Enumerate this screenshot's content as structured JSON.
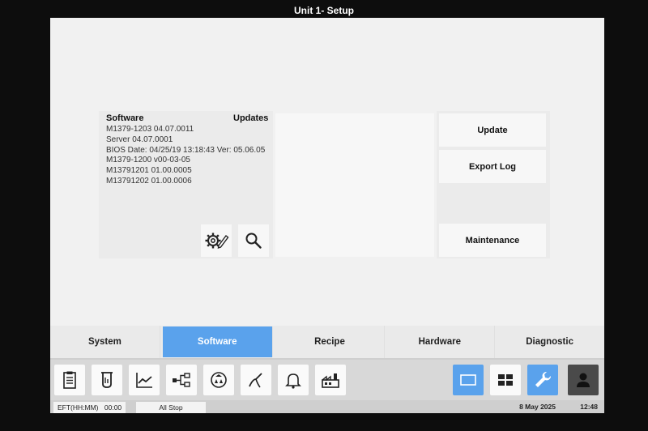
{
  "window": {
    "title": "Unit 1- Setup"
  },
  "software_panel": {
    "heading": "Software",
    "updates_heading": "Updates",
    "versions": [
      "M1379-1203 04.07.0011",
      "Server 04.07.0001",
      "BIOS Date: 04/25/19 13:18:43 Ver: 05.06.05",
      "M1379-1200 v00-03-05",
      "M13791201 01.00.0005",
      "M13791202 01.00.0006"
    ],
    "icons": {
      "settings": "gear-pencil-icon",
      "search": "magnifier-icon"
    }
  },
  "actions": {
    "update": "Update",
    "export_log": "Export Log",
    "maintenance": "Maintenance"
  },
  "tabs": [
    {
      "label": "System",
      "active": false
    },
    {
      "label": "Software",
      "active": true
    },
    {
      "label": "Recipe",
      "active": false
    },
    {
      "label": "Hardware",
      "active": false
    },
    {
      "label": "Diagnostic",
      "active": false
    }
  ],
  "toolbar": {
    "left": [
      "clipboard-icon",
      "test-tube-icon",
      "trend-chart-icon",
      "flow-diagram-icon",
      "recycle-shield-icon",
      "probe-icon",
      "bell-icon",
      "factory-icon"
    ],
    "right": [
      "single-window-icon",
      "grid-window-icon",
      "wrench-icon",
      "user-icon"
    ]
  },
  "status_bar": {
    "eft_label": "EFT(HH:MM)",
    "eft_value": "00:00",
    "stop_label": "All Stop",
    "date": "8 May 2025",
    "time": "12:48"
  },
  "colors": {
    "accent": "#5aa2ec",
    "background": "#f1f1f1",
    "dark_button": "#4a4a4a"
  }
}
